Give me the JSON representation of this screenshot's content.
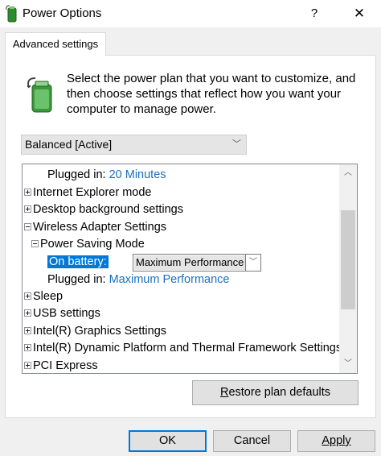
{
  "window": {
    "title": "Power Options",
    "help_label": "?",
    "close_label": "✕",
    "app_icon": "power-options-battery-icon"
  },
  "tab": {
    "label": "Advanced settings"
  },
  "description": "Select the power plan that you want to customize, and then choose settings that reflect how you want your computer to manage power.",
  "plan_select": {
    "value": "Balanced [Active]"
  },
  "tree": {
    "items": [
      {
        "label": "Plugged in:",
        "value": "20 Minutes"
      },
      {
        "label": "Internet Explorer mode",
        "expander": "+"
      },
      {
        "label": "Desktop background settings",
        "expander": "+"
      },
      {
        "label": "Wireless Adapter Settings",
        "expander": "-"
      },
      {
        "label": "Power Saving Mode",
        "expander": "-"
      },
      {
        "label": "On battery:",
        "value": "Maximum Performance",
        "selected": true
      },
      {
        "label": "Plugged in:",
        "value": "Maximum Performance"
      },
      {
        "label": "Sleep",
        "expander": "+"
      },
      {
        "label": "USB settings",
        "expander": "+"
      },
      {
        "label": "Intel(R) Graphics Settings",
        "expander": "+"
      },
      {
        "label": "Intel(R) Dynamic Platform and Thermal Framework Settings",
        "expander": "+"
      },
      {
        "label": "PCI Express",
        "expander": "+"
      }
    ]
  },
  "buttons": {
    "restore_prefix": "R",
    "restore_rest": "estore plan defaults",
    "ok": "OK",
    "cancel": "Cancel",
    "apply": "Apply"
  },
  "colors": {
    "accent": "#0078d7",
    "link_blue": "#1b6fc2"
  }
}
